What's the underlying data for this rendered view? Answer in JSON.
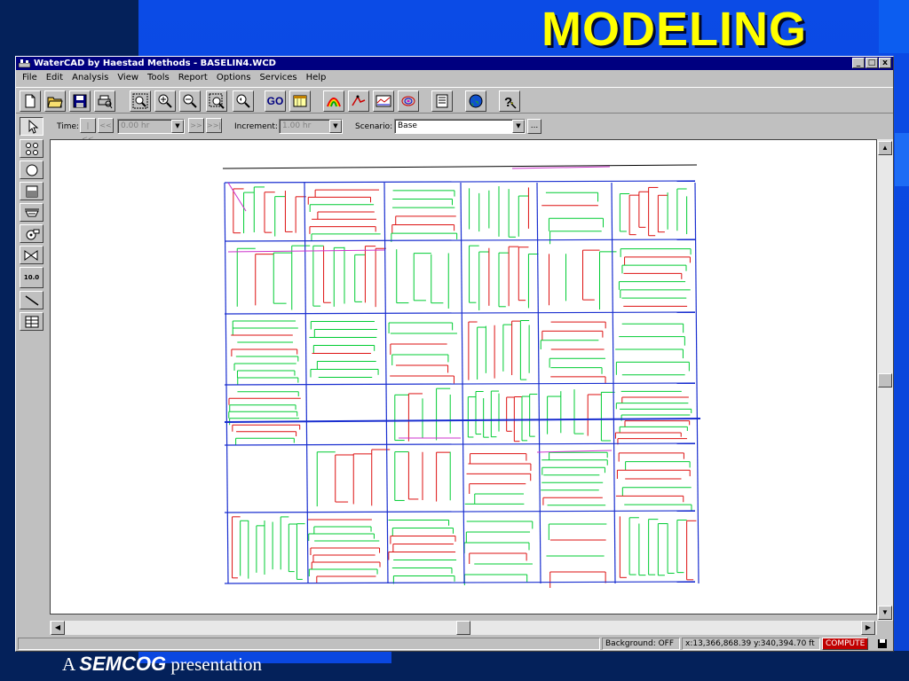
{
  "slide": {
    "title": "MODELING",
    "footer_prefix": "A",
    "footer_brand": "SEMCOG",
    "footer_suffix": "presentation"
  },
  "window": {
    "title": "WaterCAD by Haestad Methods - BASELIN4.WCD",
    "controls": [
      "_",
      "□",
      "x"
    ]
  },
  "menu": [
    "File",
    "Edit",
    "Analysis",
    "View",
    "Tools",
    "Report",
    "Options",
    "Services",
    "Help"
  ],
  "toolbar": {
    "buttons": [
      "new-file",
      "open-folder",
      "save-disk",
      "print-preview",
      "zoom-extents",
      "zoom-in",
      "zoom-out",
      "zoom-window",
      "zoom-previous",
      "go",
      "calendar",
      "color-coding",
      "annotation",
      "profile",
      "contour",
      "report",
      "globe",
      "help"
    ],
    "go_label": "GO"
  },
  "time_controls": {
    "time_label": "Time:",
    "time_value": "0.00 hr",
    "increment_label": "Increment:",
    "increment_value": "1.00 hr",
    "scenario_label": "Scenario:",
    "scenario_value": "Base",
    "ellipsis": "..."
  },
  "palette": [
    "select-arrow",
    "junction",
    "tank",
    "reservoir",
    "pump",
    "valve",
    "pressure-gauge",
    "pipe",
    "layout"
  ],
  "palette_gauge_text": "10.0",
  "status": {
    "background": "Background: OFF",
    "coords": "x:13,366,868.39  y:340,394.70 ft",
    "compute": "COMPUTE"
  },
  "colors": {
    "accent_title": "#ffff00",
    "pipe_green": "#00cc33",
    "pipe_red": "#dd1111",
    "pipe_blue": "#1a2fd0",
    "pipe_magenta": "#cc33cc",
    "window_title": "#000080"
  }
}
